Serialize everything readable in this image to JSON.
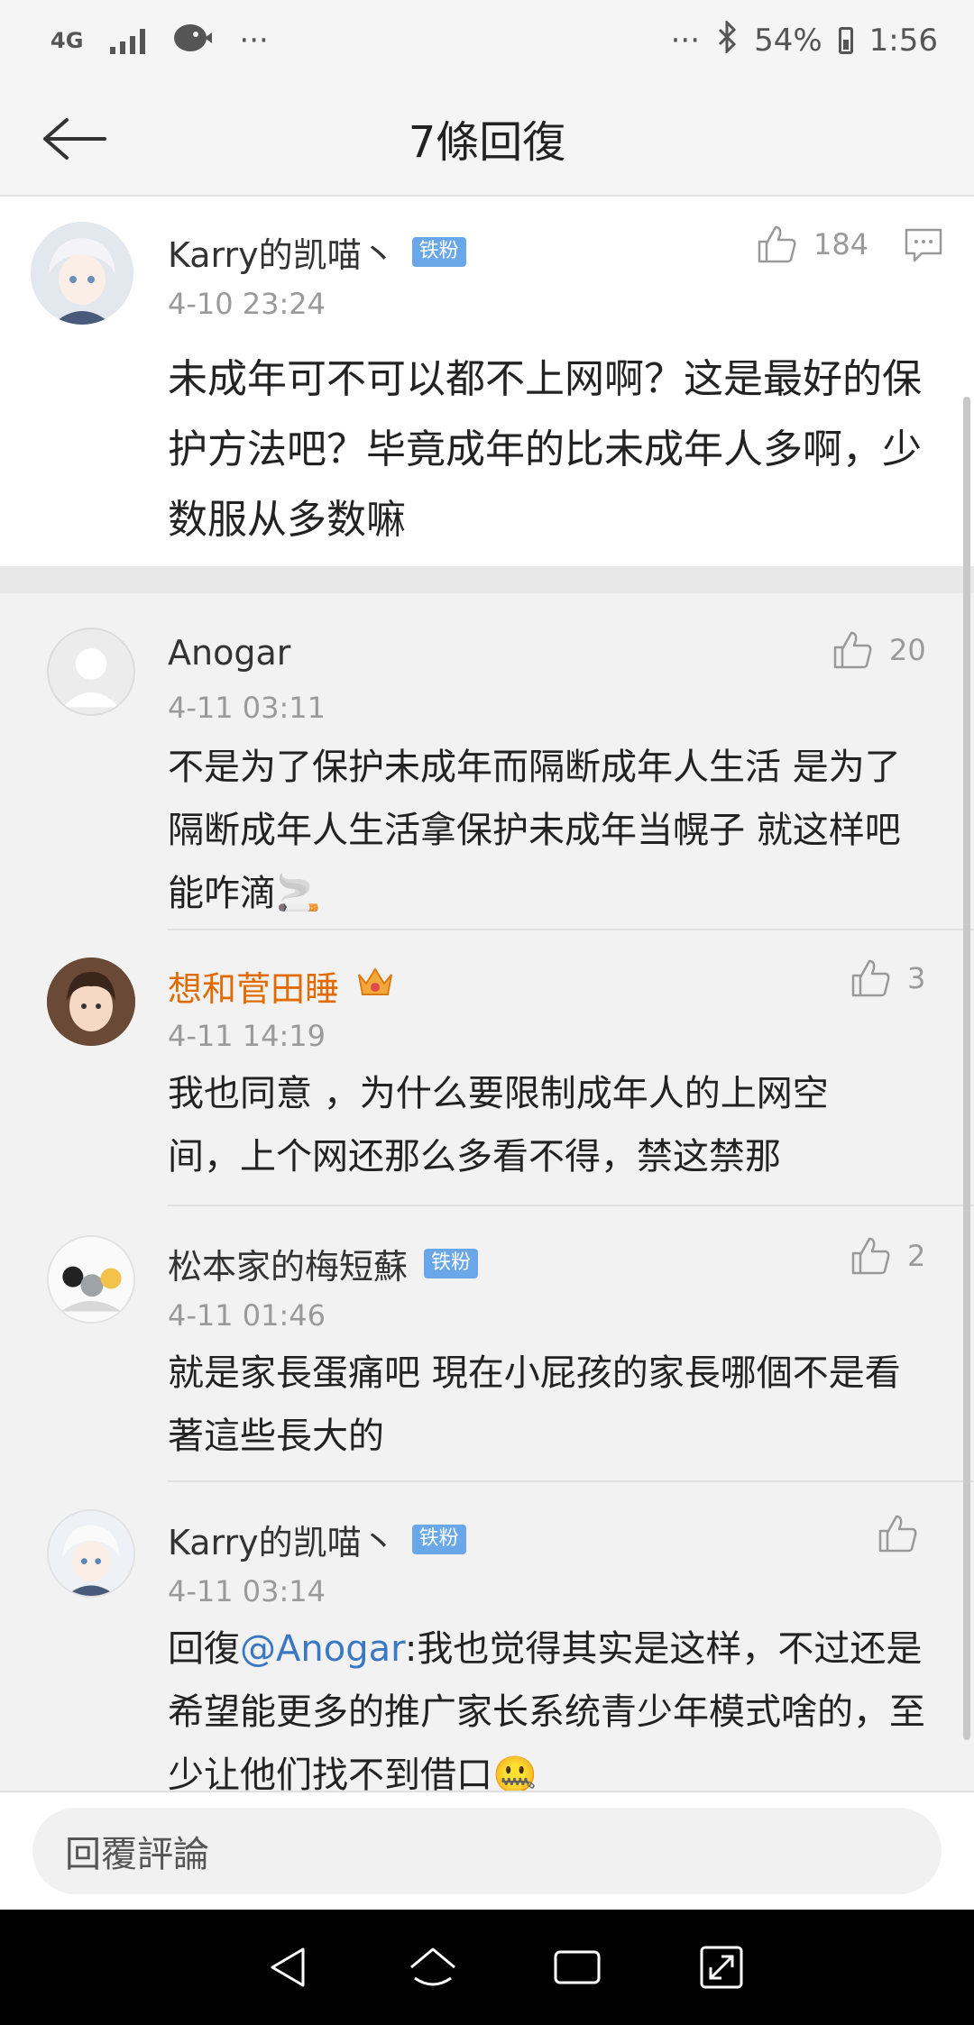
{
  "status_bar": {
    "network": "4G",
    "dots_left": "···",
    "dots_right": "···",
    "battery": "54%",
    "time": "1:56"
  },
  "header": {
    "title": "7條回復"
  },
  "main_comment": {
    "username": "Karry的凯喵丶",
    "badge": "铁粉",
    "time": "4-10 23:24",
    "likes": "184",
    "text": "未成年可不可以都不上网啊？这是最好的保护方法吧？毕竟成年的比未成年人多啊，少数服从多数嘛"
  },
  "replies": [
    {
      "username": "Anogar",
      "time": "4-11 03:11",
      "likes": "20",
      "text": "不是为了保护未成年而隔断成年人生活 是为了隔断成年人生活拿保护未成年当幌子 就这样吧能咋滴🚬"
    },
    {
      "username": "想和菅田睡",
      "time": "4-11 14:19",
      "likes": "3",
      "text": "我也同意 ，为什么要限制成年人的上网空间，上个网还那么多看不得，禁这禁那"
    },
    {
      "username": "松本家的梅短蘇",
      "badge": "铁粉",
      "time": "4-11 01:46",
      "likes": "2",
      "text": "就是家長蛋痛吧 現在小屁孩的家長哪個不是看著這些長大的"
    },
    {
      "username": "Karry的凯喵丶",
      "badge": "铁粉",
      "time": "4-11 03:14",
      "reply_prefix": "回復",
      "mention": "@Anogar",
      "text": ":我也觉得其实是这样，不过还是希望能更多的推广家长系统青少年模式啥的，至少让他们找不到借口🤐"
    }
  ],
  "reply_bar": {
    "placeholder": "回覆評論"
  },
  "colors": {
    "badge": "#6aa7e8",
    "vip_name": "#e06c00",
    "mention": "#3a78c4"
  }
}
